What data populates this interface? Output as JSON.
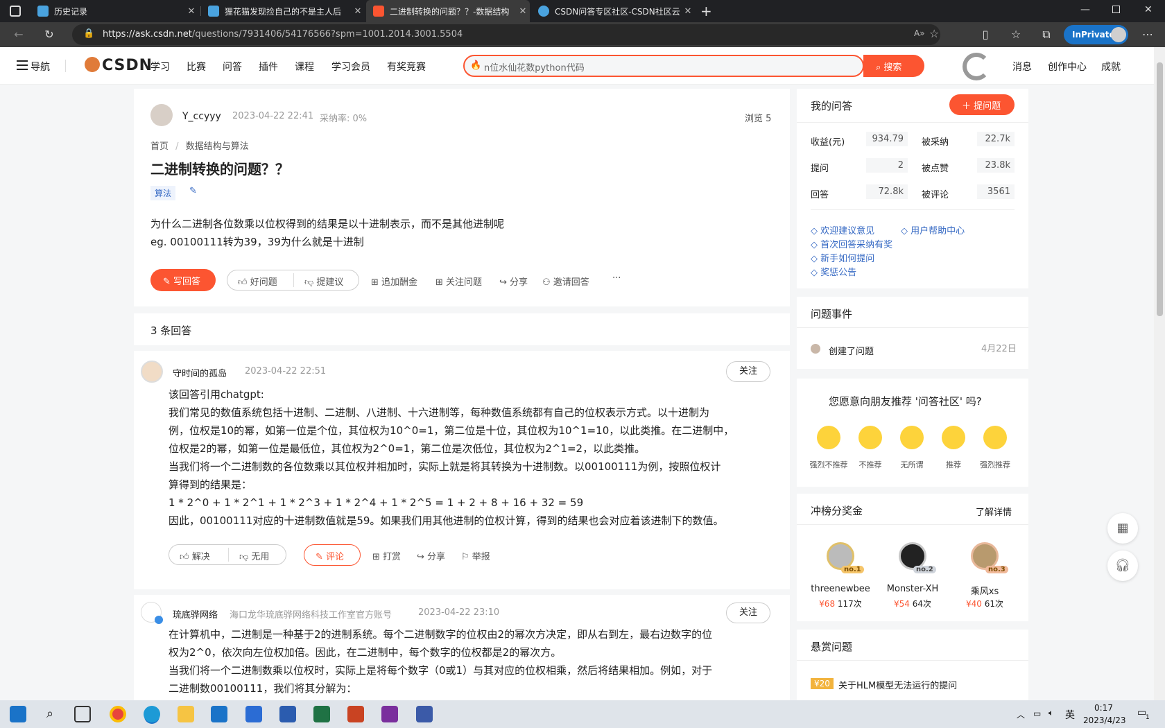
{
  "browser": {
    "tabs": [
      {
        "title": "历史记录",
        "color": "#4aa3df"
      },
      {
        "title": "狸花猫发现捡自己的不是主人后",
        "color": "#4aa3df"
      },
      {
        "title": "二进制转换的问题？？-数据结构",
        "color": "#fc5531"
      },
      {
        "title": "CSDN问答专区社区-CSDN社区云",
        "color": "#4aa3df"
      }
    ],
    "new_tab": "+",
    "url_host": "https://ask.csdn.net",
    "url_path": "/questions/7931406/54176566?spm=1001.2014.3001.5504",
    "inprivate": "InPrivate"
  },
  "header": {
    "nav_label": "导航",
    "logo": "CSDN",
    "nav": [
      "学习",
      "比赛",
      "问答",
      "插件",
      "课程",
      "学习会员",
      "有奖竞赛"
    ],
    "search_placeholder": "n位水仙花数python代码",
    "search_button": "搜索",
    "right": [
      "消息",
      "创作中心",
      "成就"
    ]
  },
  "question": {
    "author": "Y_ccyyy",
    "time": "2023-04-22 22:41",
    "accept_rate": "采纳率: 0%",
    "views": "浏览 5",
    "breadcrumb": [
      "首页",
      "数据结构与算法"
    ],
    "breadcrumb_sep": "/",
    "title": "二进制转换的问题？？",
    "tag": "算法",
    "body": [
      "为什么二进制各位数乘以位权得到的结果是以十进制表示，而不是其他进制呢",
      "eg. 00100111转为39，39为什么就是十进制"
    ],
    "actions": {
      "write": "写回答",
      "good": "好问题",
      "suggest": "提建议",
      "bounty": "追加酬金",
      "follow": "关注问题",
      "share": "分享",
      "invite": "邀请回答",
      "more": "···"
    }
  },
  "answers_count": "3 条回答",
  "answers": [
    {
      "author": "守时间的孤岛",
      "time": "2023-04-22 22:51",
      "follow": "关注",
      "lines": [
        "该回答引用chatgpt:",
        "我们常见的数值系统包括十进制、二进制、八进制、十六进制等，每种数值系统都有自己的位权表示方式。以十进制为",
        "例，位权是10的幂，如第一位是个位，其位权为10^0=1，第二位是十位，其位权为10^1=10，以此类推。在二进制中，",
        "位权是2的幂，如第一位是最低位，其位权为2^0=1，第二位是次低位，其位权为2^1=2，以此类推。",
        "当我们将一个二进制数的各位数乘以其位权并相加时，实际上就是将其转换为十进制数。以00100111为例，按照位权计",
        "算得到的结果是：",
        "1 * 2^0 + 1 * 2^1 + 1 * 2^3 + 1 * 2^4 + 1 * 2^5 = 1 + 2 + 8 + 16 + 32 = 59",
        "因此，00100111对应的十进制数值就是59。如果我们用其他进制的位权计算，得到的结果也会对应着该进制下的数值。"
      ],
      "actions": {
        "solve": "解决",
        "useless": "无用",
        "comment": "评论",
        "tip": "打赏",
        "share": "分享",
        "report": "举报"
      }
    },
    {
      "author": "琉底骅网络",
      "org": "海口龙华琉底骅网络科技工作室官方账号",
      "time": "2023-04-22 23:10",
      "follow": "关注",
      "lines": [
        "在计算机中，二进制是一种基于2的进制系统。每个二进制数字的位权由2的幂次方决定，即从右到左，最右边数字的位",
        "权为2^0，依次向左位权加倍。因此，在二进制中，每个数字的位权都是2的幂次方。",
        "当我们将一个二进制数乘以位权时，实际上是将每个数字（0或1）与其对应的位权相乘，然后将结果相加。例如，对于",
        "二进制数00100111，我们将其分解为："
      ]
    }
  ],
  "sidebar": {
    "my_answers": {
      "title": "我的问答",
      "ask_button": "提问题",
      "stats": [
        {
          "label": "收益(元)",
          "value": "934.79"
        },
        {
          "label": "被采纳",
          "value": "22.7k"
        },
        {
          "label": "提问",
          "value": "2"
        },
        {
          "label": "被点赞",
          "value": "23.8k"
        },
        {
          "label": "回答",
          "value": "72.8k"
        },
        {
          "label": "被评论",
          "value": "3561"
        }
      ],
      "links": [
        "欢迎建议意见",
        "用户帮助中心",
        "首次回答采纳有奖",
        "新手如何提问",
        "奖惩公告"
      ]
    },
    "events": {
      "title": "问题事件",
      "item": "创建了问题",
      "date": "4月22日"
    },
    "recommend": {
      "title": "您愿意向朋友推荐 '问答社区' 吗?",
      "options": [
        "强烈不推荐",
        "不推荐",
        "无所谓",
        "推荐",
        "强烈推荐"
      ]
    },
    "ranking": {
      "title": "冲榜分奖金",
      "more": "了解详情",
      "people": [
        {
          "name": "threenewbee",
          "badge": "no.1",
          "money": "¥68",
          "count": "117次"
        },
        {
          "name": "Monster-XH",
          "badge": "no.2",
          "money": "¥54",
          "count": "64次"
        },
        {
          "name": "乘风xs",
          "badge": "no.3",
          "money": "¥40",
          "count": "61次"
        }
      ]
    },
    "bounty": {
      "title": "悬赏问题",
      "badge": "¥20",
      "item": "关于HLM模型无法运行的提问"
    }
  },
  "taskbar": {
    "ime": "英",
    "time": "0:17",
    "date": "2023/4/23",
    "notif": "1"
  },
  "colors": {
    "brand": "#fc5531",
    "link": "#3468c3"
  }
}
